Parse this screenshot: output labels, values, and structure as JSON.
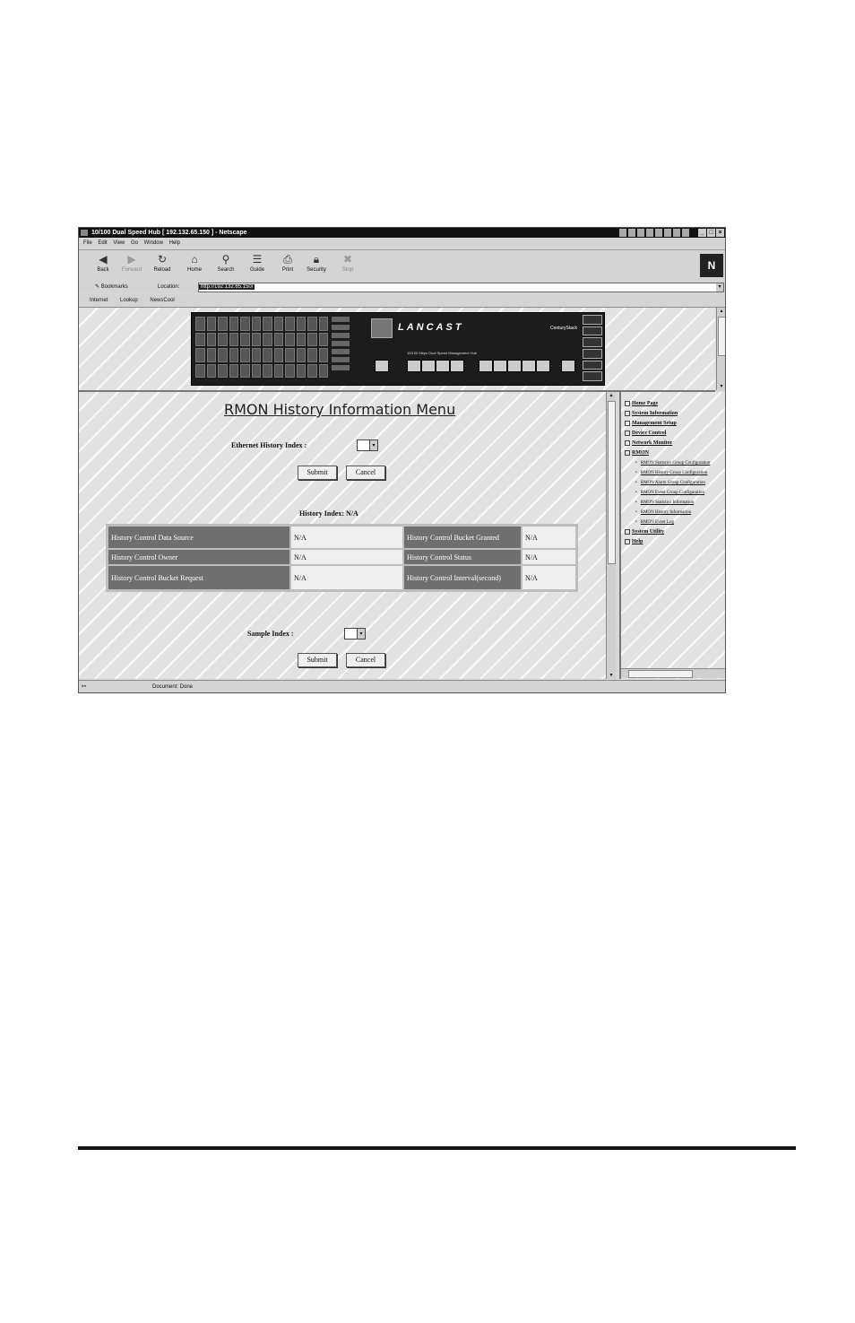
{
  "window": {
    "title": "10/100 Dual Speed Hub [ 192.132.65.150 ] - Netscape",
    "buttons": [
      "_",
      "□",
      "×"
    ]
  },
  "menu": [
    "File",
    "Edit",
    "View",
    "Go",
    "Window",
    "Help"
  ],
  "toolbar": {
    "buttons": [
      {
        "label": "Back",
        "icon": "back-arrow-icon"
      },
      {
        "label": "Forward",
        "icon": "forward-arrow-icon"
      },
      {
        "label": "Reload",
        "icon": "reload-icon"
      },
      {
        "label": "Home",
        "icon": "home-icon"
      },
      {
        "label": "Search",
        "icon": "search-icon"
      },
      {
        "label": "Guide",
        "icon": "guide-icon"
      },
      {
        "label": "Print",
        "icon": "print-icon"
      },
      {
        "label": "Security",
        "icon": "security-icon"
      },
      {
        "label": "Stop",
        "icon": "stop-icon"
      }
    ],
    "brand": "N"
  },
  "location": {
    "bookmarks_label": "Bookmarks",
    "location_label": "Location:",
    "url": "http://192.132.65.150/"
  },
  "links": [
    "Internet",
    "Lookup",
    "NewsCool"
  ],
  "device": {
    "brand": "LANCAST",
    "model": "CenturyStack",
    "label": "10/100 Mbps Dual Speed Management Hub"
  },
  "main": {
    "title": "RMON History Information Menu",
    "ethernet_index_label": "Ethernet History Index :",
    "submit_label": "Submit",
    "cancel_label": "Cancel",
    "history_index_heading": "History Index: N/A",
    "table": [
      [
        {
          "label": "History Control Data Source",
          "value": "N/A"
        },
        {
          "label": "History Control Bucket Granted",
          "value": "N/A"
        }
      ],
      [
        {
          "label": "History Control Owner",
          "value": "N/A"
        },
        {
          "label": "History Control Status",
          "value": "N/A"
        }
      ],
      [
        {
          "label": "History Control Bucket Request",
          "value": "N/A"
        },
        {
          "label": "History Control Interval(second)",
          "value": "N/A"
        }
      ]
    ],
    "sample_index_label": "Sample Index :"
  },
  "nav": {
    "items": [
      "Home Page",
      "System Information",
      "Management Setup",
      "Device Control",
      "Network Monitor",
      "RMON"
    ],
    "rmon_subitems": [
      "RMON Statistics Group Configuration",
      "RMON History Group Configuration",
      "RMON Alarm Group Configuration",
      "RMON Event Group Configuration",
      "RMON Statistics Information",
      "RMON History Information",
      "RMON Event Log"
    ],
    "items_after": [
      "System Utility",
      "Help"
    ]
  },
  "status": {
    "text": "Document: Done"
  }
}
